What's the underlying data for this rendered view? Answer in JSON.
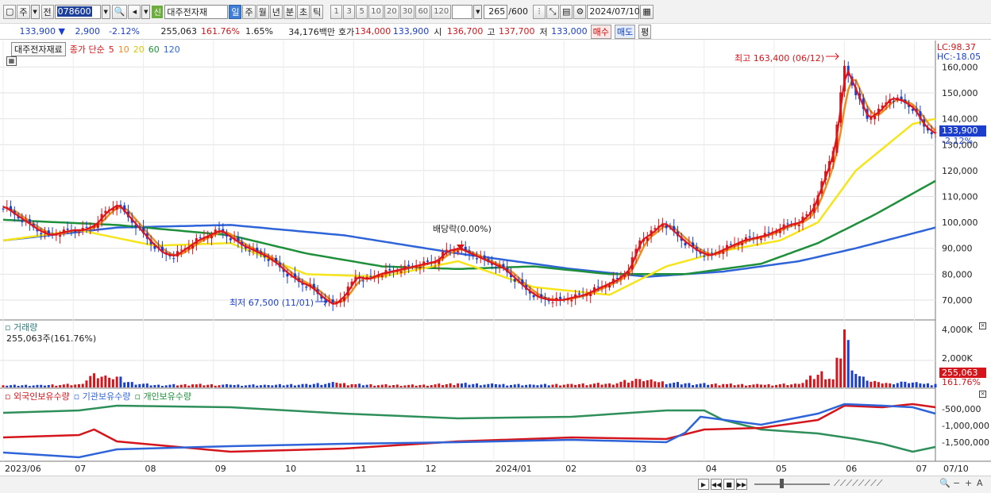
{
  "toolbar": {
    "period_type": "주",
    "prev_label": "전",
    "code": "078600",
    "name": "대주전자재",
    "new_label": "신",
    "period_buttons": [
      "일",
      "주",
      "월",
      "년",
      "분",
      "초",
      "틱"
    ],
    "interval_buttons": [
      "1",
      "3",
      "5",
      "10",
      "20",
      "30",
      "60",
      "120"
    ],
    "count": "265",
    "count_max": "/600",
    "date": "2024/07/10"
  },
  "quote": {
    "price": "133,900",
    "change": "2,900",
    "change_pct": "-2.12%",
    "volume": "255,063",
    "vol_ratio": "161.76%",
    "turnover": "1.65%",
    "amount": "34,176백만",
    "ask_label": "호가",
    "ask": "134,000",
    "bid": "133,900",
    "open_label": "시",
    "open": "136,700",
    "high_label": "고",
    "high": "137,700",
    "low_label": "저",
    "low": "133,000",
    "buy_label": "매수",
    "sell_label": "매도",
    "eval_label": "평"
  },
  "price_pane": {
    "legend_name": "대주전자재료",
    "legend_type": "종가 단순",
    "ma": [
      {
        "period": "5",
        "color": "#e0141b"
      },
      {
        "period": "10",
        "color": "#f08c1c"
      },
      {
        "period": "20",
        "color": "#f5e51a"
      },
      {
        "period": "60",
        "color": "#1e8f3a"
      },
      {
        "period": "120",
        "color": "#2f64d8"
      }
    ],
    "lc": "LC:98.37",
    "hc": "HC:-18.05",
    "high_annotation": "최고 163,400 (06/12)",
    "low_annotation": "최저 67,500 (11/01)",
    "dividend_annotation": "배당락(0.00%)",
    "last_price": "133,900",
    "last_change": "-2.12%",
    "y_ticks": [
      70000,
      80000,
      90000,
      100000,
      110000,
      120000,
      130000,
      140000,
      150000,
      160000
    ],
    "y_tick_labels": [
      "70,000",
      "80,000",
      "90,000",
      "100,000",
      "110,000",
      "120,000",
      "130,000",
      "140,000",
      "150,000",
      "160,000"
    ]
  },
  "volume_pane": {
    "title": "거래량",
    "value": "255,063주(161.76%)",
    "y_tick_labels": [
      "2,000K",
      "4,000K"
    ],
    "last_volume": "255,063",
    "last_ratio": "161.76%"
  },
  "holdings_pane": {
    "legends": [
      {
        "label": "외국인보유수량",
        "color": "#d4161c"
      },
      {
        "label": "기관보유수량",
        "color": "#2f64d8"
      },
      {
        "label": "개인보유수량",
        "color": "#1e8f3a"
      }
    ],
    "y_tick_labels": [
      "-500,000",
      "-1,000,000",
      "-1,500,000"
    ]
  },
  "x_labels": [
    "2023/06",
    "07",
    "08",
    "09",
    "10",
    "11",
    "12",
    "2024/01",
    "02",
    "03",
    "04",
    "05",
    "06",
    "07"
  ],
  "x_last": "07/10",
  "chart_data": {
    "type": "line",
    "x_start": "2023/06",
    "x_end": "2024/07/10",
    "close_series": [
      [
        0,
        106000
      ],
      [
        3,
        103000
      ],
      [
        6,
        100000
      ],
      [
        9,
        97000
      ],
      [
        12,
        95000
      ],
      [
        15,
        96000
      ],
      [
        18,
        97000
      ],
      [
        21,
        97000
      ],
      [
        24,
        99000
      ],
      [
        27,
        104000
      ],
      [
        30,
        107000
      ],
      [
        33,
        102000
      ],
      [
        36,
        97000
      ],
      [
        39,
        92000
      ],
      [
        42,
        88000
      ],
      [
        45,
        87000
      ],
      [
        48,
        90000
      ],
      [
        51,
        93000
      ],
      [
        54,
        95000
      ],
      [
        57,
        97000
      ],
      [
        60,
        94000
      ],
      [
        63,
        91000
      ],
      [
        66,
        89000
      ],
      [
        69,
        87000
      ],
      [
        72,
        84000
      ],
      [
        75,
        80000
      ],
      [
        78,
        77000
      ],
      [
        81,
        75000
      ],
      [
        84,
        71000
      ],
      [
        87,
        68000
      ],
      [
        90,
        72000
      ],
      [
        93,
        79000
      ],
      [
        96,
        78000
      ],
      [
        99,
        80000
      ],
      [
        102,
        81000
      ],
      [
        105,
        82000
      ],
      [
        108,
        83000
      ],
      [
        111,
        84000
      ],
      [
        114,
        85000
      ],
      [
        117,
        89000
      ],
      [
        120,
        90000
      ],
      [
        123,
        88000
      ],
      [
        126,
        86000
      ],
      [
        129,
        84000
      ],
      [
        132,
        82000
      ],
      [
        135,
        78000
      ],
      [
        138,
        74000
      ],
      [
        141,
        71000
      ],
      [
        144,
        70000
      ],
      [
        147,
        70000
      ],
      [
        150,
        71000
      ],
      [
        153,
        72000
      ],
      [
        156,
        74000
      ],
      [
        159,
        76000
      ],
      [
        162,
        78000
      ],
      [
        165,
        82000
      ],
      [
        168,
        93000
      ],
      [
        171,
        96000
      ],
      [
        174,
        100000
      ],
      [
        177,
        96000
      ],
      [
        180,
        92000
      ],
      [
        183,
        89000
      ],
      [
        186,
        87000
      ],
      [
        189,
        89000
      ],
      [
        192,
        91000
      ],
      [
        195,
        93000
      ],
      [
        198,
        94000
      ],
      [
        201,
        95000
      ],
      [
        204,
        97000
      ],
      [
        207,
        99000
      ],
      [
        210,
        100000
      ],
      [
        213,
        104000
      ],
      [
        216,
        115000
      ],
      [
        219,
        128000
      ],
      [
        222,
        160000
      ],
      [
        225,
        150000
      ],
      [
        228,
        140000
      ],
      [
        231,
        143000
      ],
      [
        234,
        148000
      ],
      [
        237,
        147000
      ],
      [
        240,
        144000
      ],
      [
        243,
        137000
      ],
      [
        246,
        133900
      ]
    ],
    "ma20_series": [
      [
        0,
        93000
      ],
      [
        20,
        97000
      ],
      [
        40,
        91000
      ],
      [
        60,
        92000
      ],
      [
        80,
        80000
      ],
      [
        100,
        79000
      ],
      [
        120,
        85000
      ],
      [
        140,
        75000
      ],
      [
        160,
        72000
      ],
      [
        175,
        83000
      ],
      [
        190,
        89000
      ],
      [
        205,
        93000
      ],
      [
        215,
        100000
      ],
      [
        225,
        120000
      ],
      [
        240,
        138000
      ],
      [
        246,
        140000
      ]
    ],
    "ma60_series": [
      [
        0,
        101000
      ],
      [
        30,
        99000
      ],
      [
        60,
        95000
      ],
      [
        80,
        88000
      ],
      [
        100,
        83000
      ],
      [
        120,
        82000
      ],
      [
        140,
        83000
      ],
      [
        160,
        80000
      ],
      [
        180,
        80000
      ],
      [
        200,
        84000
      ],
      [
        215,
        92000
      ],
      [
        230,
        103000
      ],
      [
        246,
        116000
      ]
    ],
    "ma120_series": [
      [
        0,
        93000
      ],
      [
        30,
        98000
      ],
      [
        60,
        99000
      ],
      [
        90,
        95000
      ],
      [
        120,
        88000
      ],
      [
        150,
        82000
      ],
      [
        170,
        79000
      ],
      [
        190,
        81000
      ],
      [
        210,
        85000
      ],
      [
        225,
        90000
      ],
      [
        246,
        98000
      ]
    ],
    "volume_k": [
      [
        0,
        160
      ],
      [
        10,
        190
      ],
      [
        20,
        240
      ],
      [
        24,
        1050
      ],
      [
        28,
        720
      ],
      [
        30,
        800
      ],
      [
        33,
        400
      ],
      [
        40,
        180
      ],
      [
        50,
        230
      ],
      [
        60,
        200
      ],
      [
        70,
        180
      ],
      [
        80,
        260
      ],
      [
        88,
        350
      ],
      [
        92,
        240
      ],
      [
        100,
        200
      ],
      [
        110,
        180
      ],
      [
        120,
        300
      ],
      [
        130,
        240
      ],
      [
        140,
        200
      ],
      [
        150,
        260
      ],
      [
        160,
        300
      ],
      [
        168,
        620
      ],
      [
        172,
        450
      ],
      [
        180,
        300
      ],
      [
        190,
        250
      ],
      [
        200,
        210
      ],
      [
        210,
        260
      ],
      [
        216,
        1200
      ],
      [
        219,
        600
      ],
      [
        222,
        4300
      ],
      [
        225,
        1000
      ],
      [
        228,
        500
      ],
      [
        231,
        400
      ],
      [
        234,
        300
      ],
      [
        238,
        420
      ],
      [
        242,
        300
      ],
      [
        246,
        255
      ]
    ]
  }
}
